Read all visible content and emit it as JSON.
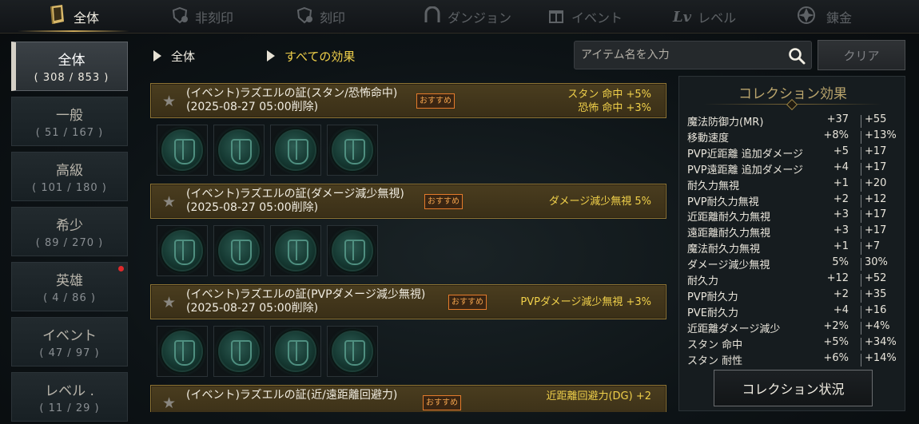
{
  "tabs": [
    {
      "label": "全体",
      "icon": "book-icon"
    },
    {
      "label": "非刻印",
      "icon": "shield-number-icon"
    },
    {
      "label": "刻印",
      "icon": "shield-number-icon"
    },
    {
      "label": "ダンジョン",
      "icon": "gate-icon"
    },
    {
      "label": "イベント",
      "icon": "gift-icon"
    },
    {
      "label": "レベル",
      "icon": "lv-icon"
    },
    {
      "label": "錬金",
      "icon": "alchemy-icon"
    }
  ],
  "sidebar": {
    "items": [
      {
        "name": "全体",
        "count": "( 308 / 853 )"
      },
      {
        "name": "一般",
        "count": "( 51 / 167 )"
      },
      {
        "name": "高級",
        "count": "( 101 / 180 )"
      },
      {
        "name": "希少",
        "count": "( 89 / 270 )"
      },
      {
        "name": "英雄",
        "count": "( 4 / 86 )"
      },
      {
        "name": "イベント",
        "count": "( 47 / 97 )"
      },
      {
        "name": "レベル .",
        "count": "( 11 / 29 )"
      }
    ]
  },
  "filters": {
    "category": "全体",
    "effect": "すべての効果"
  },
  "search": {
    "placeholder": "アイテム名を入力",
    "clear_label": "クリア"
  },
  "collections": [
    {
      "title": "(イベント)ラズエルの証(スタン/恐怖命中)",
      "deadline": "(2025-08-27  05:00削除)",
      "badge": "おすすめ",
      "effects": [
        "スタン  命中  +5%",
        "恐怖  命中  +3%"
      ]
    },
    {
      "title": "(イベント)ラズエルの証(ダメージ減少無視)",
      "deadline": "(2025-08-27  05:00削除)",
      "badge": "おすすめ",
      "effects": [
        "ダメージ減少無視  5%"
      ]
    },
    {
      "title": "(イベント)ラズエルの証(PVPダメージ減少無視)",
      "deadline": "(2025-08-27  05:00削除)",
      "badge": "おすすめ",
      "effects": [
        "PVPダメージ減少無視  +3%"
      ]
    },
    {
      "title": "(イベント)ラズエルの証(近/遠距離回避力)",
      "deadline": "",
      "badge": "おすすめ",
      "effects": [
        "近距離回避力(DG)  +2"
      ]
    }
  ],
  "panel": {
    "title": "コレクション効果",
    "stats": [
      {
        "name": "魔法防御力(MR)",
        "value": "+37",
        "max": "+55"
      },
      {
        "name": "移動速度",
        "value": "+8%",
        "max": "+13%"
      },
      {
        "name": "PVP近距離  追加ダメージ",
        "value": "+5",
        "max": "+17"
      },
      {
        "name": "PVP遠距離  追加ダメージ",
        "value": "+4",
        "max": "+17"
      },
      {
        "name": "耐久力無視",
        "value": "+1",
        "max": "+20"
      },
      {
        "name": "PVP耐久力無視",
        "value": "+2",
        "max": "+12"
      },
      {
        "name": "近距離耐久力無視",
        "value": "+3",
        "max": "+17"
      },
      {
        "name": "遠距離耐久力無視",
        "value": "+3",
        "max": "+17"
      },
      {
        "name": "魔法耐久力無視",
        "value": "+1",
        "max": "+7"
      },
      {
        "name": "ダメージ減少無視",
        "value": "5%",
        "max": "30%"
      },
      {
        "name": "耐久力",
        "value": "+12",
        "max": "+52"
      },
      {
        "name": "PVP耐久力",
        "value": "+2",
        "max": "+35"
      },
      {
        "name": "PVE耐久力",
        "value": "+4",
        "max": "+16"
      },
      {
        "name": "近距離ダメージ減少",
        "value": "+2%",
        "max": "+4%"
      },
      {
        "name": "スタン  命中",
        "value": "+5%",
        "max": "+34%"
      },
      {
        "name": "スタン  耐性",
        "value": "+6%",
        "max": "+14%"
      }
    ],
    "status_button": "コレクション状況"
  }
}
